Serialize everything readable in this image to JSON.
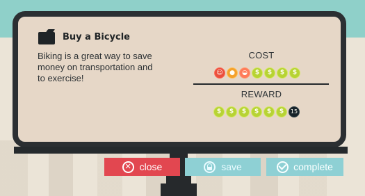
{
  "card": {
    "title": "Buy a Bicycle",
    "description": "Biking is a great way to save\nmoney on transportation and\nto exercise!",
    "icon": "wallet-icon"
  },
  "cost": {
    "label": "COST",
    "tokens": [
      {
        "type": "happiness",
        "color": "#ea4f3d",
        "symbol": "☺"
      },
      {
        "type": "energy",
        "color": "#f4a12c",
        "symbol": "●"
      },
      {
        "type": "food",
        "color": "#ff7b59",
        "symbol": "◒"
      },
      {
        "type": "money",
        "color": "#b7d334",
        "symbol": "$"
      },
      {
        "type": "money",
        "color": "#b7d334",
        "symbol": "$"
      },
      {
        "type": "money",
        "color": "#b7d334",
        "symbol": "$"
      },
      {
        "type": "money",
        "color": "#b7d334",
        "symbol": "$"
      }
    ]
  },
  "reward": {
    "label": "REWARD",
    "tokens": [
      {
        "type": "money",
        "color": "#b7d334",
        "symbol": "$"
      },
      {
        "type": "money",
        "color": "#b7d334",
        "symbol": "$"
      },
      {
        "type": "money",
        "color": "#b7d334",
        "symbol": "$"
      },
      {
        "type": "money",
        "color": "#b7d334",
        "symbol": "$"
      },
      {
        "type": "money",
        "color": "#b7d334",
        "symbol": "$"
      },
      {
        "type": "money",
        "color": "#b7d334",
        "symbol": "$"
      },
      {
        "type": "time",
        "color": "#162229",
        "symbol": "15"
      }
    ]
  },
  "buttons": {
    "close": "close",
    "save": "save",
    "complete": "complete"
  },
  "colors": {
    "board": "#e6d7c7",
    "frame": "#2b2f32",
    "close_button": "#e24750",
    "secondary_button": "#8ed0d4"
  }
}
